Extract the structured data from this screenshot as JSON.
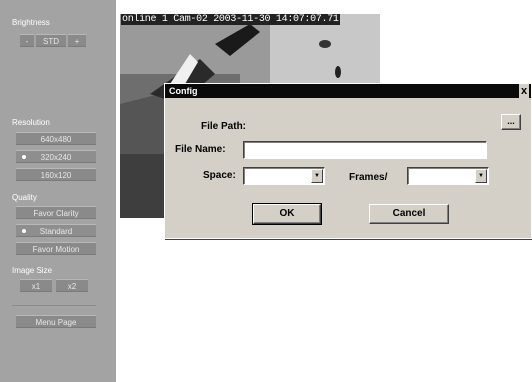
{
  "sidebar": {
    "brightness": {
      "label": "Brightness",
      "minus": "-",
      "std": "STD",
      "plus": "+"
    },
    "resolution": {
      "label": "Resolution",
      "options": [
        "640x480",
        "320x240",
        "160x120"
      ],
      "selected": "320x240"
    },
    "quality": {
      "label": "Quality",
      "options": [
        "Favor Clarity",
        "Standard",
        "Favor Motion"
      ],
      "selected": "Standard"
    },
    "image_size": {
      "label": "Image Size",
      "x1": "x1",
      "x2": "x2"
    },
    "menu_page": "Menu Page"
  },
  "video": {
    "overlay": "online 1 Cam-02 2003-11-30 14:07:07.71"
  },
  "dialog": {
    "title": "Config",
    "close": "x",
    "file_path_label": "File Path:",
    "browse_label": "...",
    "file_name_label": "File Name:",
    "file_name_value": "",
    "space_label": "Space:",
    "frames_label": "Frames/",
    "ok_label": "OK",
    "cancel_label": "Cancel"
  },
  "colors": {
    "sidebar_bg": "#a3a3a3",
    "dialog_bg": "#d4d0c8",
    "titlebar_bg": "#0a0a0a"
  }
}
